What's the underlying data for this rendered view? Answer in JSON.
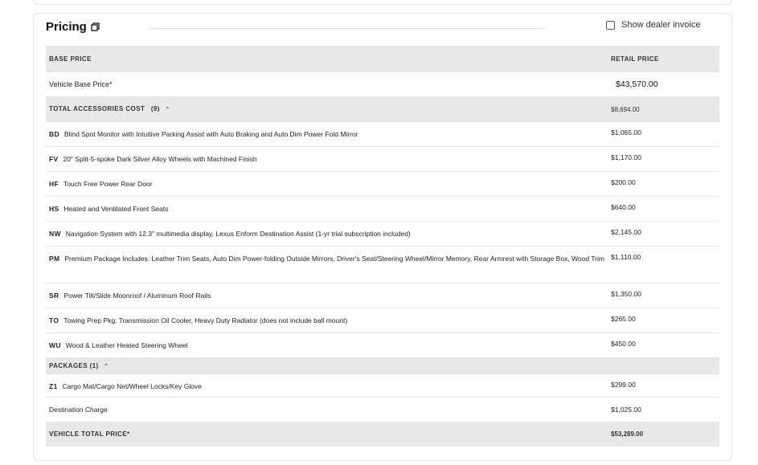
{
  "pricing": {
    "title": "Pricing",
    "show_dealer_invoice_label": "Show dealer invoice",
    "show_dealer_invoice_checked": false
  },
  "table": {
    "base_header": {
      "label": "BASE PRICE",
      "price_label": "RETAIL PRICE"
    },
    "vehicle_base": {
      "label": "Vehicle Base Price*",
      "price": "$43,570.00"
    },
    "accessories_header": {
      "label": "TOTAL ACCESSORIES COST",
      "count": "(9)",
      "chevron": "⌃",
      "price": "$8,694.00"
    },
    "accessories": [
      {
        "code": "BD",
        "desc": "Blind Spot Monitor with Intuitive Parking Assist with Auto Braking and Auto Dim Power Fold Mirror",
        "price": "$1,065.00"
      },
      {
        "code": "FV",
        "desc": "20\" Split-5-spoke Dark Silver Alloy Wheels with Machined Finish",
        "price": "$1,170.00"
      },
      {
        "code": "HF",
        "desc": "Touch Free Power Rear Door",
        "price": "$200.00"
      },
      {
        "code": "HS",
        "desc": "Heated and Ventilated Front Seats",
        "price": "$640.00"
      },
      {
        "code": "NW",
        "desc": "Navigation System with 12.3\" multimedia display, Lexus Enform Destination Assist (1-yr trial subscription included)",
        "price": "$2,145.00"
      },
      {
        "code": "PM",
        "desc": "Premium Package Includes: Leather Trim Seats, Auto Dim Power-folding Outside Mirrors, Driver's Seat/Steering Wheel/Mirror Memory, Rear Armrest with Storage Box, Wood Trim",
        "price": "$1,110.00"
      },
      {
        "code": "SR",
        "desc": "Power Tilt/Slide Moonroof / Aluminum Roof Rails",
        "price": "$1,350.00"
      },
      {
        "code": "TO",
        "desc": "Towing Prep Pkg: Transmission Oil Cooler, Heavy Duty Radiator (does not include ball mount)",
        "price": "$265.00"
      },
      {
        "code": "WU",
        "desc": "Wood & Leather Heated Steering Wheel",
        "price": "$450.00"
      }
    ],
    "packages_header": {
      "label": "PACKAGES (1)",
      "chevron": "⌃"
    },
    "packages": [
      {
        "code": "Z1",
        "desc": "Cargo Mat/Cargo Net/Wheel Locks/Key Glove",
        "price": "$299.00"
      }
    ],
    "destination": {
      "label": "Destination Charge",
      "price": "$1,025.00"
    },
    "total": {
      "label": "VEHICLE TOTAL PRICE*",
      "price": "$53,289.00"
    }
  }
}
